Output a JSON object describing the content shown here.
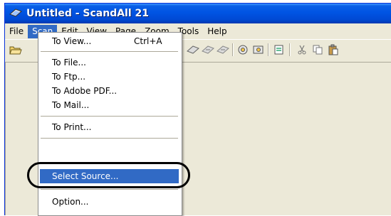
{
  "window": {
    "title": "Untitled - ScandAll 21"
  },
  "menubar": {
    "items": [
      {
        "label": "File"
      },
      {
        "label": "Scan"
      },
      {
        "label": "Edit"
      },
      {
        "label": "View"
      },
      {
        "label": "Page"
      },
      {
        "label": "Zoom"
      },
      {
        "label": "Tools"
      },
      {
        "label": "Help"
      }
    ],
    "active": "Scan"
  },
  "scan_menu": {
    "to_view": {
      "label": "To View...",
      "shortcut": "Ctrl+A"
    },
    "to_file": {
      "label": "To File..."
    },
    "to_ftp": {
      "label": "To Ftp..."
    },
    "to_pdf": {
      "label": "To Adobe PDF..."
    },
    "to_mail": {
      "label": "To Mail..."
    },
    "to_print": {
      "label": "To Print..."
    },
    "select_source": {
      "label": "Select Source..."
    },
    "option": {
      "label": "Option..."
    }
  },
  "toolbar": {
    "icons": [
      "open-folder-icon",
      "scan-arrow-icon",
      "scan-arrow-icon",
      "scan-arrow-icon",
      "gear-scan-icon",
      "gear-scan-icon",
      "page-scan-icon",
      "cut-icon",
      "copy-icon",
      "paste-icon"
    ]
  },
  "colors": {
    "title_bar": "#0054e3",
    "highlight": "#316ac5",
    "menu_bg": "#ece9d8"
  }
}
